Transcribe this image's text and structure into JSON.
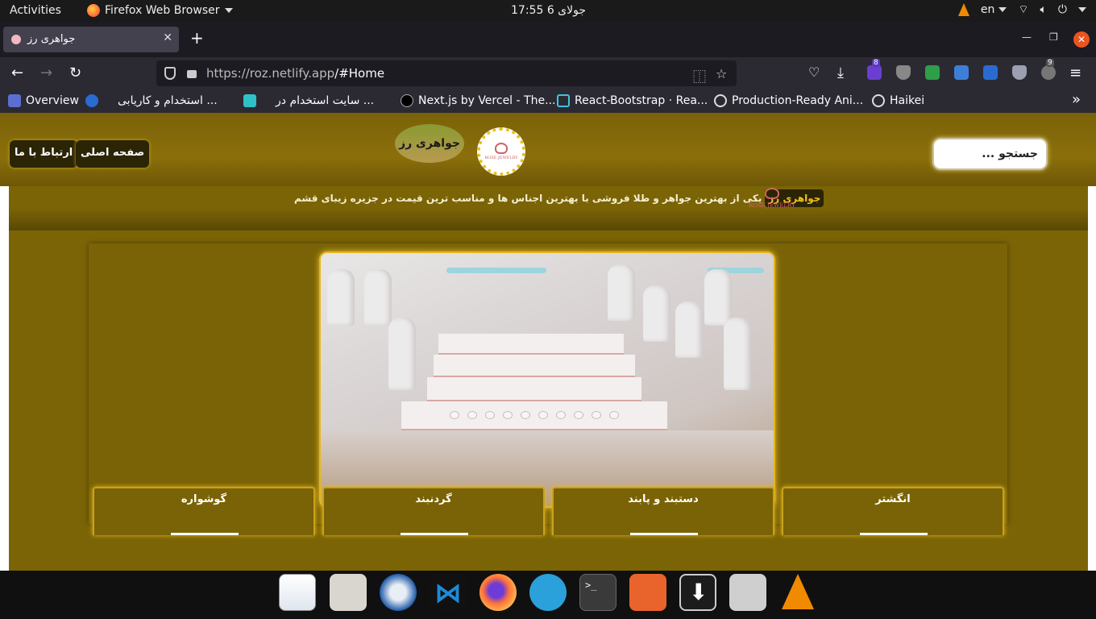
{
  "topbar": {
    "activities": "Activities",
    "app_name": "Firefox Web Browser",
    "clock": "جولای 6  17:55",
    "lang": "en"
  },
  "tabs": [
    {
      "title": "جواهری رز"
    }
  ],
  "nav": {
    "url_host": "https://roz.netlify.app",
    "url_path": "/#Home",
    "ext_badge_1": "8",
    "ext_badge_2": "9"
  },
  "bookmarks": [
    {
      "label": "Overview"
    },
    {
      "label": "استخدام و کاریابی ..."
    },
    {
      "label": "سایت استخدام در ..."
    },
    {
      "label": "Next.js by Vercel - The..."
    },
    {
      "label": "React-Bootstrap · Rea..."
    },
    {
      "label": "Production-Ready Ani..."
    },
    {
      "label": "Haikei"
    }
  ],
  "site": {
    "contact_button": "ارتباط با ما",
    "home_button": "صفحه اصلی",
    "brand": "جواهری رز",
    "logo_text": "ROSE JEWELRY",
    "search_placeholder": "جستجو ...",
    "tagline_highlight": "جواهری رز",
    "tagline_text": "یکی از بهترین جواهر و طلا فروشی با بهترین اجناس ها و مناسب ترین قیمت در جزیره زیبای قشم",
    "categories": [
      "گوشواره",
      "گردنبند",
      "دستبند و پابند",
      "انگشتر"
    ]
  },
  "colors": {
    "header_gold": "#8b6f0a",
    "main_bg": "#7b6406",
    "button_dark": "#2b2405",
    "accent_glow": "#f0c030"
  }
}
